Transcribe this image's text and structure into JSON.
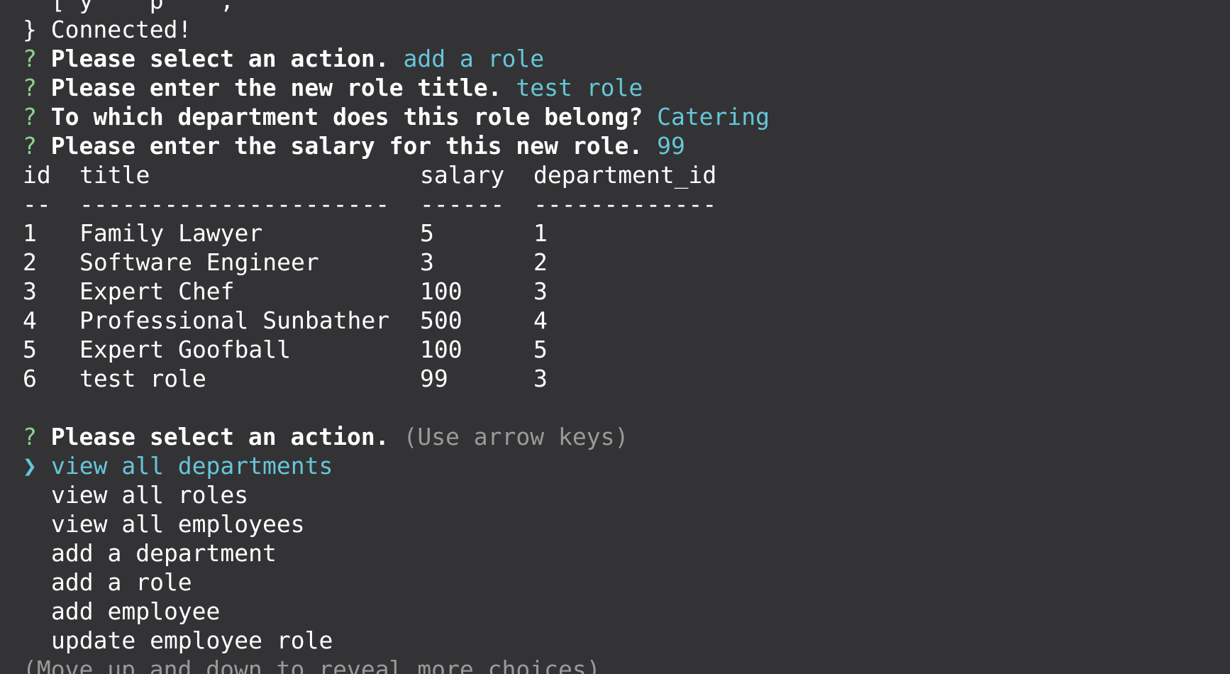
{
  "top_partial": "  [ y    p    ,  ",
  "connected": "} Connected!",
  "prompts": [
    {
      "question": "Please select an action.",
      "answer": "add a role"
    },
    {
      "question": "Please enter the new role title.",
      "answer": "test role"
    },
    {
      "question": "To which department does this role belong?",
      "answer": "Catering"
    },
    {
      "question": "Please enter the salary for this new role.",
      "answer": "99"
    }
  ],
  "prompt_marker": "?",
  "table": {
    "headers": [
      "id",
      "title",
      "salary",
      "department_id"
    ],
    "separators": [
      "--",
      "----------------------",
      "------",
      "-------------"
    ],
    "rows": [
      [
        "1",
        "Family Lawyer",
        "5",
        "1"
      ],
      [
        "2",
        "Software Engineer",
        "3",
        "2"
      ],
      [
        "3",
        "Expert Chef",
        "100",
        "3"
      ],
      [
        "4",
        "Professional Sunbather",
        "500",
        "4"
      ],
      [
        "5",
        "Expert Goofball",
        "100",
        "5"
      ],
      [
        "6",
        "test role",
        "99",
        "3"
      ]
    ]
  },
  "menu": {
    "question": "Please select an action.",
    "hint": "(Use arrow keys)",
    "pointer": "❯",
    "choices": [
      "view all departments",
      "view all roles",
      "view all employees",
      "add a department",
      "add a role",
      "add employee",
      "update employee role"
    ],
    "selected_index": 0,
    "footer": "(Move up and down to reveal more choices)"
  },
  "colors": {
    "background": "#333335",
    "prompt_marker": "#8bd38f",
    "answer": "#66c6d9",
    "hint": "#9a9a9a"
  }
}
